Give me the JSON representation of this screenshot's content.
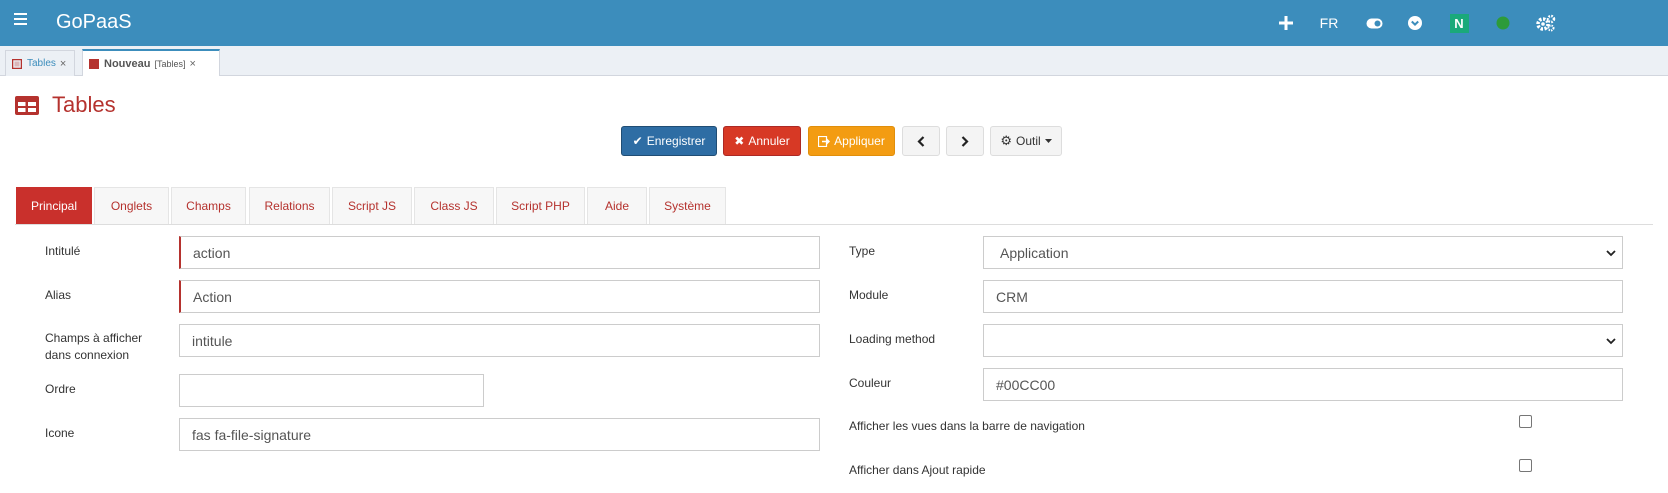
{
  "app": {
    "brand": "GoPaaS",
    "lang": "FR",
    "user_badge": "N",
    "accent": "#3c8dbc",
    "title_color": "#b5322e",
    "status_color": "#2d9b3a",
    "badge_color": "#1aa97a"
  },
  "doc_tabs": [
    {
      "label": "Tables",
      "close": "×"
    },
    {
      "label": "Nouveau",
      "suffix": "[Tables]",
      "close": "×"
    }
  ],
  "page": {
    "title": "Tables",
    "icon": "table-icon"
  },
  "toolbar": {
    "save": "Enregistrer",
    "cancel": "Annuler",
    "apply": "Appliquer",
    "tool": "Outil"
  },
  "tabs": [
    "Principal",
    "Onglets",
    "Champs",
    "Relations",
    "Script JS",
    "Class JS",
    "Script PHP",
    "Aide",
    "Système"
  ],
  "left_fields": {
    "intitule": {
      "label": "Intitulé",
      "value": "action"
    },
    "alias": {
      "label": "Alias",
      "value": "Action"
    },
    "champs": {
      "label_line1": "Champs à afficher",
      "label_line2": "dans connexion",
      "value": "intitule"
    },
    "ordre": {
      "label": "Ordre",
      "value": ""
    },
    "icone": {
      "label": "Icone",
      "value": "fas fa-file-signature"
    }
  },
  "right_fields": {
    "type": {
      "label": "Type",
      "value": "Application"
    },
    "module": {
      "label": "Module",
      "value": "CRM"
    },
    "loading": {
      "label": "Loading method",
      "value": ""
    },
    "couleur": {
      "label": "Couleur",
      "value": "#00CC00"
    },
    "vues_nav": {
      "label": "Afficher les vues dans la barre de navigation",
      "checked": false
    },
    "ajout_rapide": {
      "label": "Afficher dans Ajout rapide",
      "checked": false
    }
  }
}
